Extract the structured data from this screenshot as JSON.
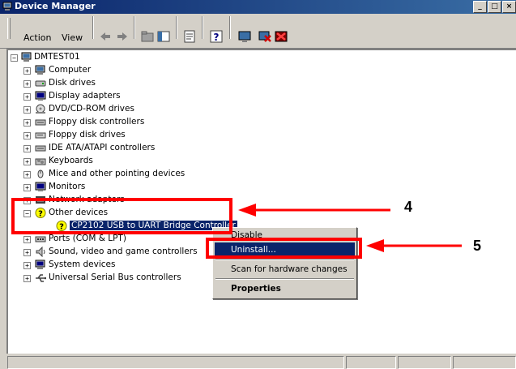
{
  "window": {
    "title": "Device Manager",
    "controls": [
      "_",
      "□",
      "×"
    ]
  },
  "menu": {
    "action": "Action",
    "view": "View"
  },
  "toolbar": {
    "buttons": [
      "back-arrow",
      "forward-arrow",
      "up-folder",
      "show-hide-tree",
      "properties",
      "help",
      "scan-hardware",
      "uninstall",
      "disable"
    ]
  },
  "tree": {
    "root": "DMTEST01",
    "items": [
      {
        "label": "Computer",
        "icon": "computer-icon"
      },
      {
        "label": "Disk drives",
        "icon": "disk-icon"
      },
      {
        "label": "Display adapters",
        "icon": "monitor-icon"
      },
      {
        "label": "DVD/CD-ROM drives",
        "icon": "cdrom-icon"
      },
      {
        "label": "Floppy disk controllers",
        "icon": "controller-icon"
      },
      {
        "label": "Floppy disk drives",
        "icon": "floppy-icon"
      },
      {
        "label": "IDE ATA/ATAPI controllers",
        "icon": "controller-icon"
      },
      {
        "label": "Keyboards",
        "icon": "keyboard-icon"
      },
      {
        "label": "Mice and other pointing devices",
        "icon": "mouse-icon"
      },
      {
        "label": "Monitors",
        "icon": "monitor-icon"
      },
      {
        "label": "Network adapters",
        "icon": "network-icon"
      },
      {
        "label": "Other devices",
        "icon": "unknown-device-icon"
      },
      {
        "label": "CP2102 USB to UART Bridge Controller",
        "icon": "unknown-device-icon"
      },
      {
        "label": "Ports (COM & LPT)",
        "icon": "port-icon"
      },
      {
        "label": "Sound, video and game controllers",
        "icon": "sound-icon"
      },
      {
        "label": "System devices",
        "icon": "system-icon"
      },
      {
        "label": "Universal Serial Bus controllers",
        "icon": "usb-icon"
      }
    ]
  },
  "context_menu": {
    "items": [
      "Disable",
      "Uninstall...",
      "Scan for hardware changes",
      "Properties"
    ]
  },
  "annotations": {
    "callout_4": "4",
    "callout_5": "5"
  },
  "colors": {
    "highlight": "#0a246a",
    "annotation": "#ff0000"
  }
}
